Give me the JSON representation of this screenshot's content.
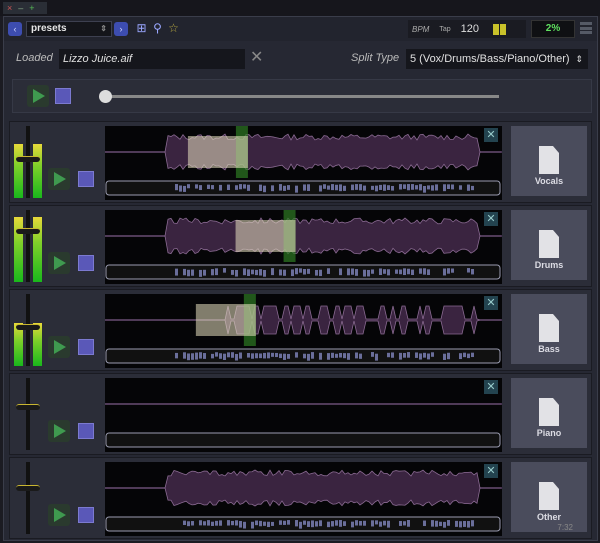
{
  "window": {
    "buttons": [
      "×",
      "–",
      "+"
    ]
  },
  "toolbar": {
    "preset": "presets",
    "prev": "‹",
    "next": "›",
    "bpm_label": "BPM",
    "tap_label": "Tap",
    "bpm": "120",
    "cpu": "2%"
  },
  "loaded": {
    "label": "Loaded",
    "file": "Lizzo Juice.aif",
    "clear": "✕"
  },
  "split": {
    "label": "Split Type",
    "value": "5 (Vox/Drums/Bass/Piano/Other)"
  },
  "transport": {
    "position": 0
  },
  "tracks": [
    {
      "name": "Vocals",
      "level": 0.75,
      "fader": 0.55,
      "playhead": 0.36
    },
    {
      "name": "Drums",
      "level": 0.9,
      "fader": 0.72,
      "playhead": 0.48
    },
    {
      "name": "Bass",
      "level": 0.6,
      "fader": 0.55,
      "playhead": 0.38
    },
    {
      "name": "Piano",
      "level": 0,
      "fader": 0.6,
      "playhead": null
    },
    {
      "name": "Other",
      "level": 0,
      "fader": 0.65,
      "playhead": null
    }
  ],
  "footer": {
    "time": "7:32"
  },
  "colors": {
    "accent": "#3d4db0",
    "play": "#3f9a4f",
    "stop": "#5a58b8",
    "cpu": "#5fe05f"
  }
}
